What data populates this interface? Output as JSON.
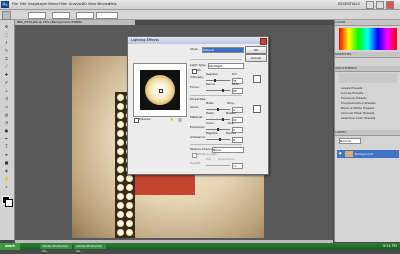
{
  "app": {
    "logo_text": "Ps",
    "menus": [
      "File",
      "Edit",
      "Image",
      "Layer",
      "Select",
      "Filter",
      "Analysis",
      "3D",
      "View",
      "Window",
      "Help"
    ],
    "workspace": "ESSENTIALS"
  },
  "document": {
    "tab_title": "IMG_0579.JPG @ 25% (Background, RGB/8)"
  },
  "dialog": {
    "title": "Lighting Effects",
    "style_label": "Style:",
    "style_value": "Default",
    "ok": "OK",
    "cancel": "Cancel",
    "light_type_label": "Light Type:",
    "light_type_value": "Spotlight",
    "on_label": "On",
    "intensity_label": "Intensity:",
    "intensity_left": "Negative",
    "intensity_right": "Full",
    "intensity_value": "35",
    "focus_label": "Focus:",
    "focus_left": "Narrow",
    "focus_right": "Wide",
    "focus_value": "69",
    "properties_label": "Properties:",
    "gloss_label": "Gloss:",
    "gloss_left": "Matte",
    "gloss_right": "Shiny",
    "gloss_value": "0",
    "material_label": "Material:",
    "material_left": "Plastic",
    "material_right": "Metallic",
    "material_value": "69",
    "exposure_label": "Exposure:",
    "exposure_left": "Under",
    "exposure_right": "Over",
    "exposure_value": "0",
    "ambience_label": "Ambience:",
    "ambience_left": "Negative",
    "ambience_right": "Positive",
    "ambience_value": "8",
    "texture_label": "Texture Channel:",
    "texture_value": "None",
    "white_high_label": "White is high",
    "height_label": "Height:",
    "height_left": "Flat",
    "height_right": "Mountainous",
    "height_value": "50",
    "preview_label": "Preview"
  },
  "panels": {
    "tabs": [
      "COLOR",
      "SWATCHES",
      "ADJUSTMENTS",
      "MASKS",
      "LAYERS",
      "CHANNELS",
      "PATHS"
    ],
    "adjustment_items": [
      "Levels Presets",
      "Curves Presets",
      "Exposure Presets",
      "Hue/Saturation Presets",
      "Black & White Presets",
      "Channel Mixer Presets",
      "Selective Color Presets"
    ],
    "layers_mode": "Normal",
    "layer_name": "Background"
  },
  "taskbar": {
    "start": "start",
    "tasks": [
      "Adobe Photoshop CS...",
      "Adobe Photoshop CS..."
    ],
    "clock": "9:54 PM"
  }
}
